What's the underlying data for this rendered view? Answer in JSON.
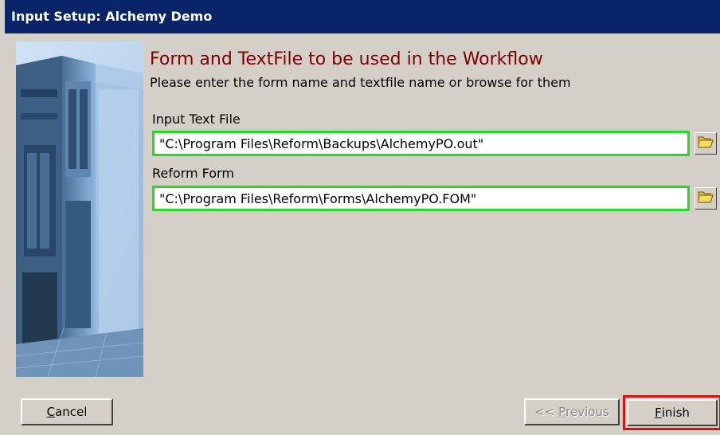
{
  "window": {
    "title": "Input Setup: Alchemy Demo"
  },
  "header": {
    "heading": "Form and TextFile to be used in the Workflow",
    "subtitle": "Please enter the form name and textfile name or browse for them"
  },
  "fields": {
    "input_text_file": {
      "label": "Input Text File",
      "value": "\"C:\\Program Files\\Reform\\Backups\\AlchemyPO.out\""
    },
    "reform_form": {
      "label": "Reform Form",
      "value": "\"C:\\Program Files\\Reform\\Forms\\AlchemyPO.FOM\""
    }
  },
  "buttons": {
    "cancel": {
      "hotkey": "C",
      "rest": "ancel"
    },
    "previous": {
      "prefix": "<< ",
      "hotkey": "P",
      "rest": "revious",
      "enabled": false
    },
    "finish": {
      "hotkey": "F",
      "rest": "inish"
    }
  },
  "icons": {
    "browse": "folder-open-icon",
    "side_image": "server-rack-image"
  },
  "colors": {
    "titlebar": "#0a246a",
    "heading": "#800000",
    "input_highlight": "#22dd22",
    "finish_highlight": "#d81010"
  }
}
